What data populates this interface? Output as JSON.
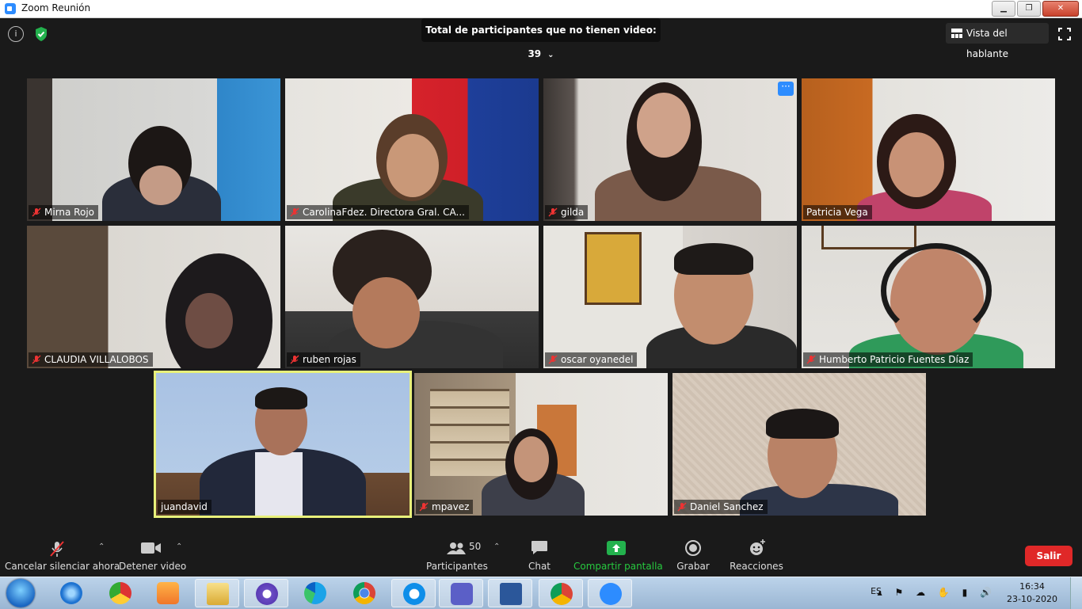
{
  "window": {
    "title": "Zoom Reunión",
    "buttons": [
      "▁",
      "❐",
      "✕"
    ]
  },
  "topbar": {
    "no_video_label": "Total de participantes que no tienen video: 39",
    "speaker_view_label": "Vista del hablante"
  },
  "participants": [
    {
      "name": "Mirna Rojo",
      "muted": true
    },
    {
      "name": "CarolinaFdez. Directora Gral. CA...",
      "muted": true
    },
    {
      "name": "gilda",
      "muted": true
    },
    {
      "name": "Patricia Vega",
      "muted": false
    },
    {
      "name": "CLAUDIA VILLALOBOS",
      "muted": true
    },
    {
      "name": "ruben rojas",
      "muted": true
    },
    {
      "name": "oscar oyanedel",
      "muted": true
    },
    {
      "name": "Humberto Patricio Fuentes Díaz",
      "muted": true
    },
    {
      "name": "juandavid",
      "muted": false,
      "active_speaker": true
    },
    {
      "name": "mpavez",
      "muted": true
    },
    {
      "name": "Daniel Sanchez",
      "muted": true
    }
  ],
  "toolbar": {
    "unmute_label": "Cancelar silenciar ahora",
    "stop_video_label": "Detener video",
    "participants_label": "Participantes",
    "participants_count": "50",
    "chat_label": "Chat",
    "share_label": "Compartir pantalla",
    "record_label": "Grabar",
    "reactions_label": "Reacciones",
    "leave_label": "Salir"
  },
  "taskbar": {
    "apps": [
      "internet-explorer",
      "chrome-old",
      "media-player",
      "file-explorer",
      "app-purple",
      "edge",
      "chrome",
      "teamviewer",
      "teams",
      "word",
      "chrome-profile",
      "zoom"
    ],
    "language": "ES",
    "time": "16:34",
    "date": "23-10-2020"
  },
  "colors": {
    "zoom_blue": "#2d8cff",
    "leave_red": "#e02828",
    "share_green": "#27c93f",
    "active_outline": "#e8f07a"
  }
}
